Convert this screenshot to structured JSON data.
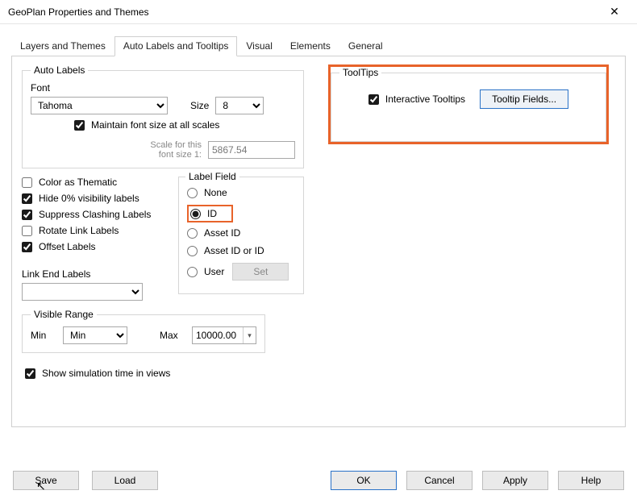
{
  "window": {
    "title": "GeoPlan Properties and Themes"
  },
  "tabs": [
    {
      "label": "Layers and Themes"
    },
    {
      "label": "Auto Labels and Tooltips"
    },
    {
      "label": "Visual"
    },
    {
      "label": "Elements"
    },
    {
      "label": "General"
    }
  ],
  "active_tab_index": 1,
  "auto_labels": {
    "legend": "Auto Labels",
    "font_label": "Font",
    "font_value": "Tahoma",
    "size_label": "Size",
    "size_value": "8",
    "maintain_label": "Maintain font size at all scales",
    "maintain_checked": true,
    "scale_label_line1": "Scale for this",
    "scale_label_line2": "font size 1:",
    "scale_value": "5867.54"
  },
  "check_options": {
    "color_as_thematic": {
      "label": "Color as Thematic",
      "checked": false
    },
    "hide_zero": {
      "label": "Hide 0% visibility labels",
      "checked": true
    },
    "suppress_clash": {
      "label": "Suppress Clashing Labels",
      "checked": true
    },
    "rotate_link": {
      "label": "Rotate Link Labels",
      "checked": false
    },
    "offset_labels": {
      "label": "Offset Labels",
      "checked": true
    }
  },
  "label_field": {
    "legend": "Label Field",
    "options": {
      "none": "None",
      "id": "ID",
      "asset_id": "Asset ID",
      "asset_id_or_id": "Asset ID or ID",
      "user": "User"
    },
    "selected": "id",
    "set_button": "Set"
  },
  "link_end": {
    "legend": "Link End Labels",
    "value": ""
  },
  "visible_range": {
    "legend": "Visible Range",
    "min_label": "Min",
    "min_value": "Min",
    "max_label": "Max",
    "max_value": "10000.00"
  },
  "tooltips": {
    "legend": "ToolTips",
    "interactive_label": "Interactive Tooltips",
    "interactive_checked": true,
    "fields_button": "Tooltip Fields..."
  },
  "show_sim": {
    "label": "Show simulation time in views",
    "checked": true
  },
  "buttons": {
    "save": "Save",
    "load": "Load",
    "ok": "OK",
    "cancel": "Cancel",
    "apply": "Apply",
    "help": "Help"
  }
}
